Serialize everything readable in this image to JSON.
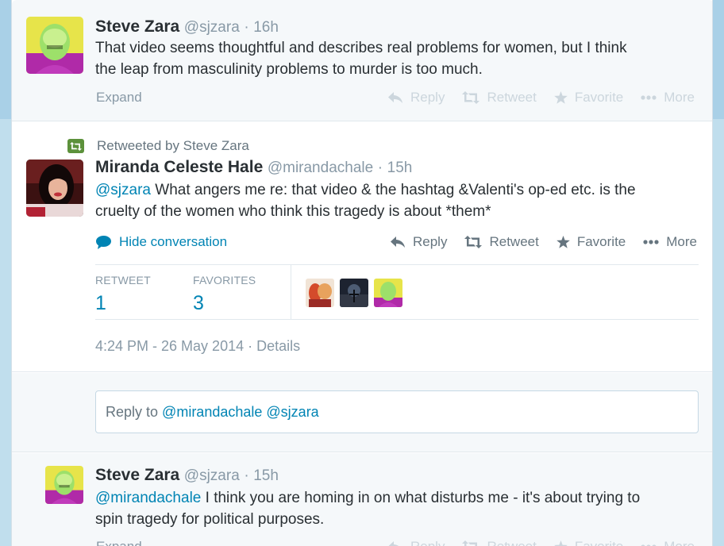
{
  "tweets": {
    "previous": {
      "name": "Steve Zara",
      "handle": "@sjzara",
      "separator": "·",
      "time": "16h",
      "text_line1": "That video seems thoughtful and describes real problems for women, but I think",
      "text_line2": "the leap from masculinity problems to murder is too much.",
      "expand_label": "Expand",
      "actions": {
        "reply": "Reply",
        "retweet": "Retweet",
        "favorite": "Favorite",
        "more": "More"
      }
    },
    "main": {
      "retweeted_by": "Retweeted by Steve Zara",
      "name": "Miranda Celeste Hale",
      "handle": "@mirandachale",
      "separator": "·",
      "time": "15h",
      "mention": "@sjzara",
      "text_line1_rest": " What angers me re: that video & the hashtag &Valenti's op-ed etc. is the",
      "text_line2": "cruelty of the women who think this tragedy is about *them*",
      "hide_conversation": "Hide conversation",
      "actions": {
        "reply": "Reply",
        "retweet": "Retweet",
        "favorite": "Favorite",
        "more": "More"
      },
      "stats": {
        "retweet_label": "RETWEET",
        "retweet_count": "1",
        "favorites_label": "FAVORITES",
        "favorites_count": "3"
      },
      "timestamp": "4:24 PM - 26 May 2014",
      "timestamp_sep": "·",
      "details": "Details"
    },
    "reply": {
      "prefix": "Reply to ",
      "mention1": "@mirandachale",
      "mention2": "@sjzara"
    },
    "next": {
      "name": "Steve Zara",
      "handle": "@sjzara",
      "separator": "·",
      "time": "15h",
      "mention": "@mirandachale",
      "text_line1_rest": " I think you are homing in on what disturbs me - it's about trying to",
      "text_line2": "spin tragedy for political purposes.",
      "expand_label": "Expand",
      "actions": {
        "reply": "Reply",
        "retweet": "Retweet",
        "favorite": "Favorite",
        "more": "More"
      }
    }
  },
  "colors": {
    "link": "#0084b4",
    "muted": "#8899a6",
    "retweet_badge": "#5c913b",
    "page_bg": "#c0deed"
  },
  "icons": [
    "reply-icon",
    "retweet-icon",
    "star-icon",
    "more-dots-icon",
    "speech-bubble-icon"
  ]
}
